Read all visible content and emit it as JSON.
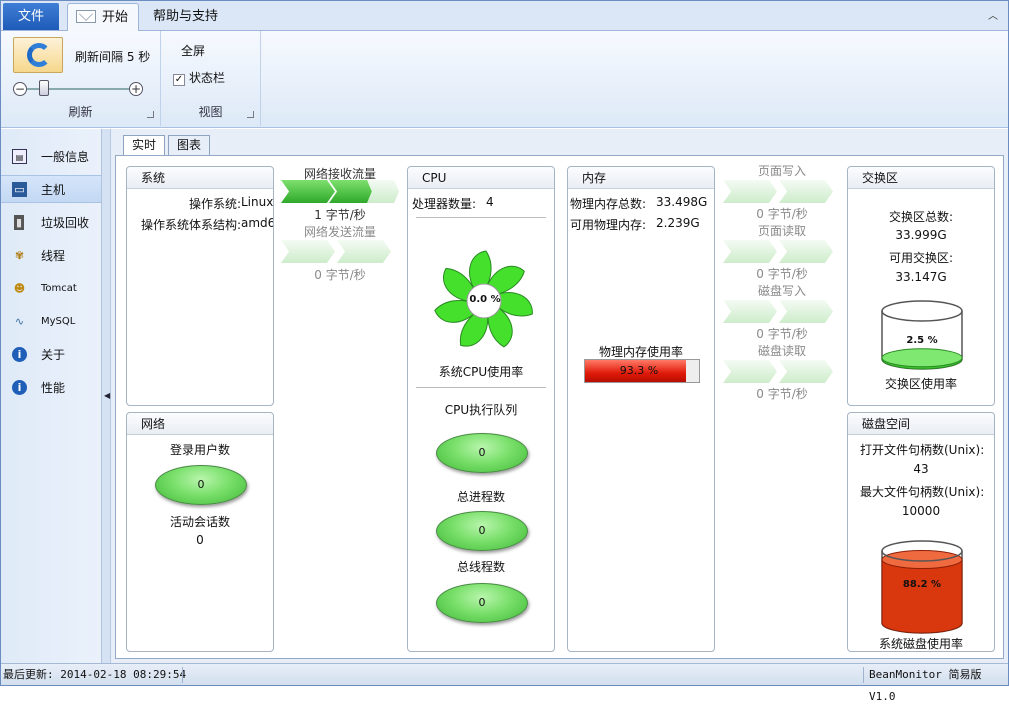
{
  "tabs": {
    "file": "文件",
    "home": "开始",
    "help": "帮助与支持"
  },
  "ribbon": {
    "refresh_interval_label": "刷新间隔 5 秒",
    "refresh_group": "刷新",
    "fullscreen": "全屏",
    "statusbar_check": "状态栏",
    "statusbar_checked": true,
    "view_group": "视图",
    "slider_minus": "−",
    "slider_plus": "+"
  },
  "nav": [
    {
      "label": "一般信息",
      "icon": "info-card-icon"
    },
    {
      "label": "主机",
      "icon": "monitor-icon",
      "selected": true
    },
    {
      "label": "垃圾回收",
      "icon": "trash-icon"
    },
    {
      "label": "线程",
      "icon": "thread-icon"
    },
    {
      "label": "Tomcat",
      "icon": "tomcat-icon"
    },
    {
      "label": "MySQL",
      "icon": "mysql-icon"
    },
    {
      "label": "关于",
      "icon": "about-icon"
    },
    {
      "label": "性能",
      "icon": "performance-icon"
    }
  ],
  "subtabs": {
    "realtime": "实时",
    "chart": "图表"
  },
  "system": {
    "title": "系统",
    "os_label": "操作系统:",
    "os_value": "Linux",
    "arch_label": "操作系统体系结构:",
    "arch_value": "amd6"
  },
  "network": {
    "title": "网络",
    "login_users": "登录用户数",
    "login_value": "0",
    "sessions": "活动会话数",
    "sessions_value": "0"
  },
  "net_flow": {
    "recv_title": "网络接收流量",
    "recv_value": "1 字节/秒",
    "send_title": "网络发送流量",
    "send_value": "0 字节/秒"
  },
  "cpu": {
    "title": "CPU",
    "proc_count_label": "处理器数量:",
    "proc_count_value": "4",
    "usage_value": "0.0 %",
    "usage_label": "系统CPU使用率",
    "queue_label": "CPU执行队列",
    "queue_value": "0",
    "total_proc_label": "总进程数",
    "total_proc_value": "0",
    "total_thread_label": "总线程数",
    "total_thread_value": "0"
  },
  "memory": {
    "title": "内存",
    "total_label": "物理内存总数:",
    "total_value": "33.498G",
    "avail_label": "可用物理内存:",
    "avail_value": "2.239G",
    "usage_label": "物理内存使用率",
    "usage_text": "93.3 %",
    "usage_fraction": 0.933
  },
  "io_flow": {
    "page_write": "页面写入",
    "page_write_value": "0 字节/秒",
    "page_read": "页面读取",
    "page_read_value": "0 字节/秒",
    "disk_write": "磁盘写入",
    "disk_write_value": "0 字节/秒",
    "disk_read": "磁盘读取",
    "disk_read_value": "0 字节/秒"
  },
  "swap": {
    "title": "交换区",
    "total_label": "交换区总数:",
    "total_value": "33.999G",
    "avail_label": "可用交换区:",
    "avail_value": "33.147G",
    "usage_text": "2.5 %",
    "usage_label": "交换区使用率",
    "usage_fraction": 0.025
  },
  "disk": {
    "title": "磁盘空间",
    "open_files_label": "打开文件句柄数(Unix):",
    "open_files_value": "43",
    "max_files_label": "最大文件句柄数(Unix):",
    "max_files_value": "10000",
    "usage_text": "88.2 %",
    "usage_label": "系统磁盘使用率",
    "usage_fraction": 0.882
  },
  "status": {
    "last_update": "最后更新: 2014-02-18 08:29:54",
    "version": "BeanMonitor 简易版 V1.0"
  },
  "colors": {
    "green": "#3fb836",
    "red": "#e01a0a",
    "accent": "#1e5bb8"
  }
}
